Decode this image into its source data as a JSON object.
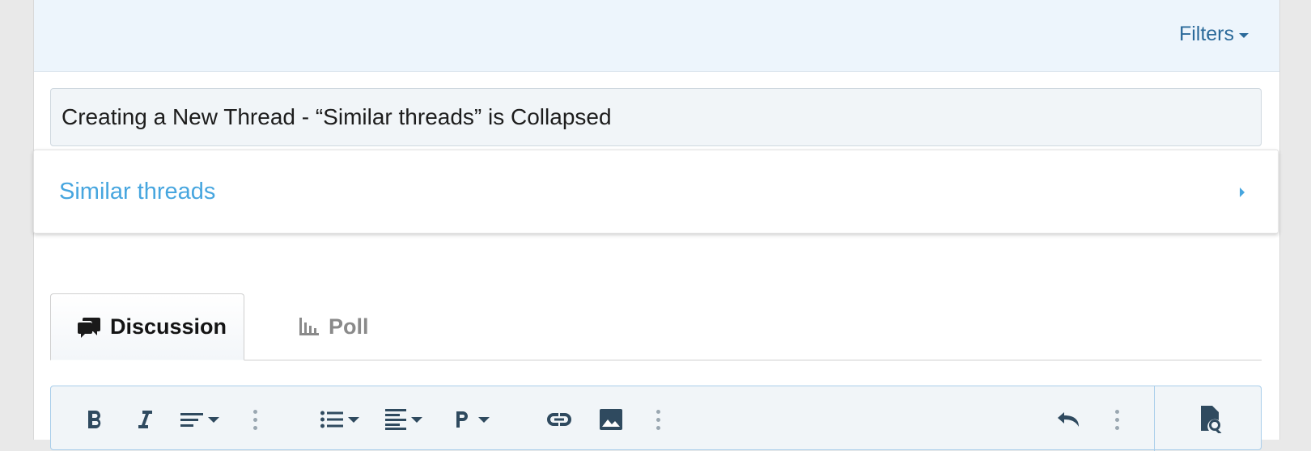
{
  "header": {
    "filters_label": "Filters"
  },
  "thread": {
    "title_value": "Creating a New Thread - “Similar threads” is Collapsed"
  },
  "similar_threads": {
    "label": "Similar threads"
  },
  "tabs": [
    {
      "label": "Discussion",
      "icon": "comments-icon",
      "active": true
    },
    {
      "label": "Poll",
      "icon": "bar-chart-icon",
      "active": false
    }
  ],
  "toolbar": {
    "icons": [
      "bold-icon",
      "italic-icon",
      "text-format-icon",
      "more-icon",
      "list-icon",
      "align-icon",
      "paragraph-icon",
      "link-icon",
      "image-icon",
      "more-icon",
      "undo-icon",
      "more-icon",
      "preview-icon"
    ]
  },
  "colors": {
    "accent": "#47a6df",
    "filters_link": "#2b6a9a",
    "topbar_bg": "#edf5fc"
  }
}
